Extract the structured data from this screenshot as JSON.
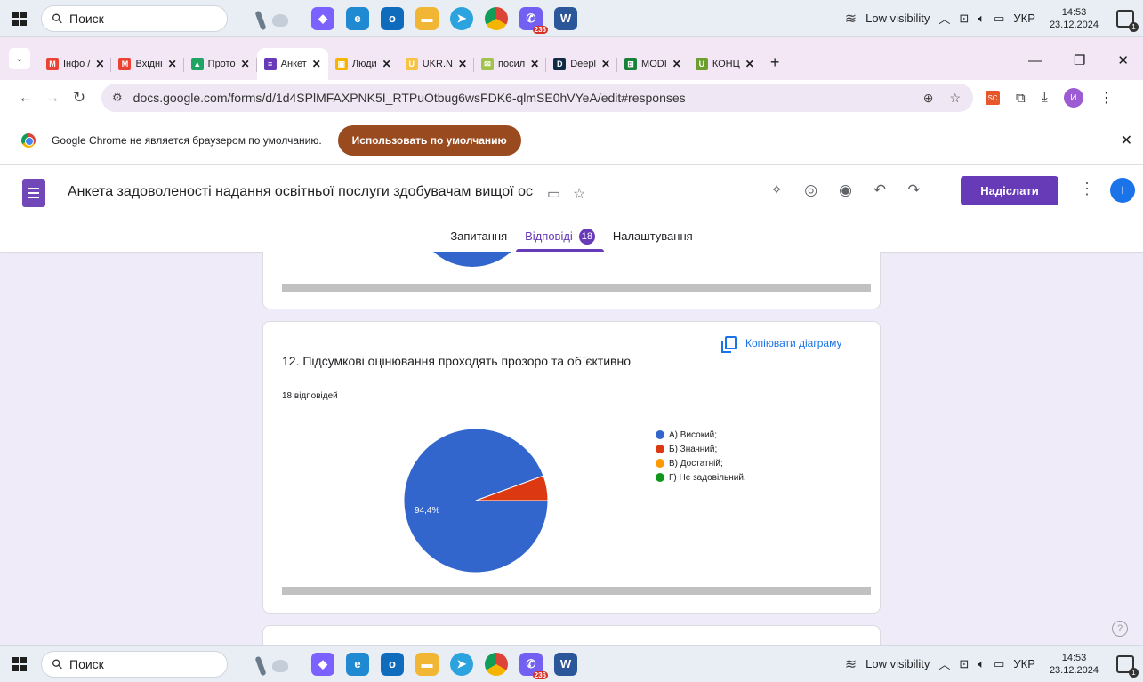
{
  "taskbar": {
    "search_label": "Поиск",
    "tray_weather": "Low visibility",
    "tray_lang": "УКР",
    "time": "14:53",
    "date": "23.12.2024",
    "viber_badge": "236",
    "apps": [
      {
        "name": "copilot",
        "glyph": "◆",
        "color": "#7b61ff"
      },
      {
        "name": "edge",
        "glyph": "e",
        "color": "#1f8ad2"
      },
      {
        "name": "outlook",
        "glyph": "o",
        "color": "#0f6cbd"
      },
      {
        "name": "file-explorer",
        "glyph": "▬",
        "color": "#f2b635"
      },
      {
        "name": "telegram",
        "glyph": "➤",
        "color": "#2aa3de"
      },
      {
        "name": "chrome",
        "glyph": "●",
        "color": "#e8453c"
      },
      {
        "name": "viber",
        "glyph": "✆",
        "color": "#7360f2"
      },
      {
        "name": "word",
        "glyph": "W",
        "color": "#2b579a"
      }
    ]
  },
  "browser": {
    "tabs": [
      {
        "label": "Інфо /",
        "fav": "M",
        "color": "#ea4335",
        "active": false
      },
      {
        "label": "Вхідні",
        "fav": "M",
        "color": "#ea4335",
        "active": false
      },
      {
        "label": "Прото",
        "fav": "▲",
        "color": "#1fa463",
        "active": false
      },
      {
        "label": "Анкет",
        "fav": "≡",
        "color": "#673ab7",
        "active": true
      },
      {
        "label": "Люди",
        "fav": "▣",
        "color": "#f4b400",
        "active": false
      },
      {
        "label": "UKR.N",
        "fav": "U",
        "color": "#f6c344",
        "active": false
      },
      {
        "label": "посил",
        "fav": "✉",
        "color": "#a0c44b",
        "active": false
      },
      {
        "label": "Deepl",
        "fav": "D",
        "color": "#0f2b46",
        "active": false
      },
      {
        "label": "MODI",
        "fav": "⊞",
        "color": "#188038",
        "active": false
      },
      {
        "label": "КОНЦ",
        "fav": "U",
        "color": "#6b9e2e",
        "active": false
      }
    ],
    "url": "docs.google.com/forms/d/1d4SPlMFAXPNK5I_RTPuOtbug6wsFDK6-qlmSE0hVYeA/edit#responses",
    "profile_initial": "И",
    "ext_label": "SC"
  },
  "infobar": {
    "message": "Google Chrome не является браузером по умолчанию.",
    "button": "Использовать по умолчанию"
  },
  "form": {
    "title": "Анкета задоволеності надання освітньої послуги здобувачам вищої ос",
    "send_label": "Надіслати",
    "account_initial": "I",
    "tabs": [
      {
        "label": "Запитання",
        "active": false
      },
      {
        "label": "Відповіді",
        "active": true,
        "badge": "18"
      },
      {
        "label": "Налаштування",
        "active": false
      }
    ]
  },
  "question": {
    "title": "12. Підсумкові оцінювання проходять прозоро та об`єктивно",
    "responses": "18 відповідей",
    "copy_label": "Копіювати діаграму"
  },
  "chart_data": {
    "type": "pie",
    "title": "12. Підсумкові оцінювання проходять прозоро та об`єктивно",
    "categories": [
      "А) Високий;",
      "Б) Значний;",
      "В) Достатній;",
      "Г) Не задовільний."
    ],
    "values": [
      94.4,
      5.6,
      0,
      0
    ],
    "colors": [
      "#3366cc",
      "#dc3912",
      "#ff9900",
      "#109618"
    ],
    "slice_labels": [
      "94,4%",
      "",
      "",
      ""
    ],
    "legend_position": "right"
  }
}
